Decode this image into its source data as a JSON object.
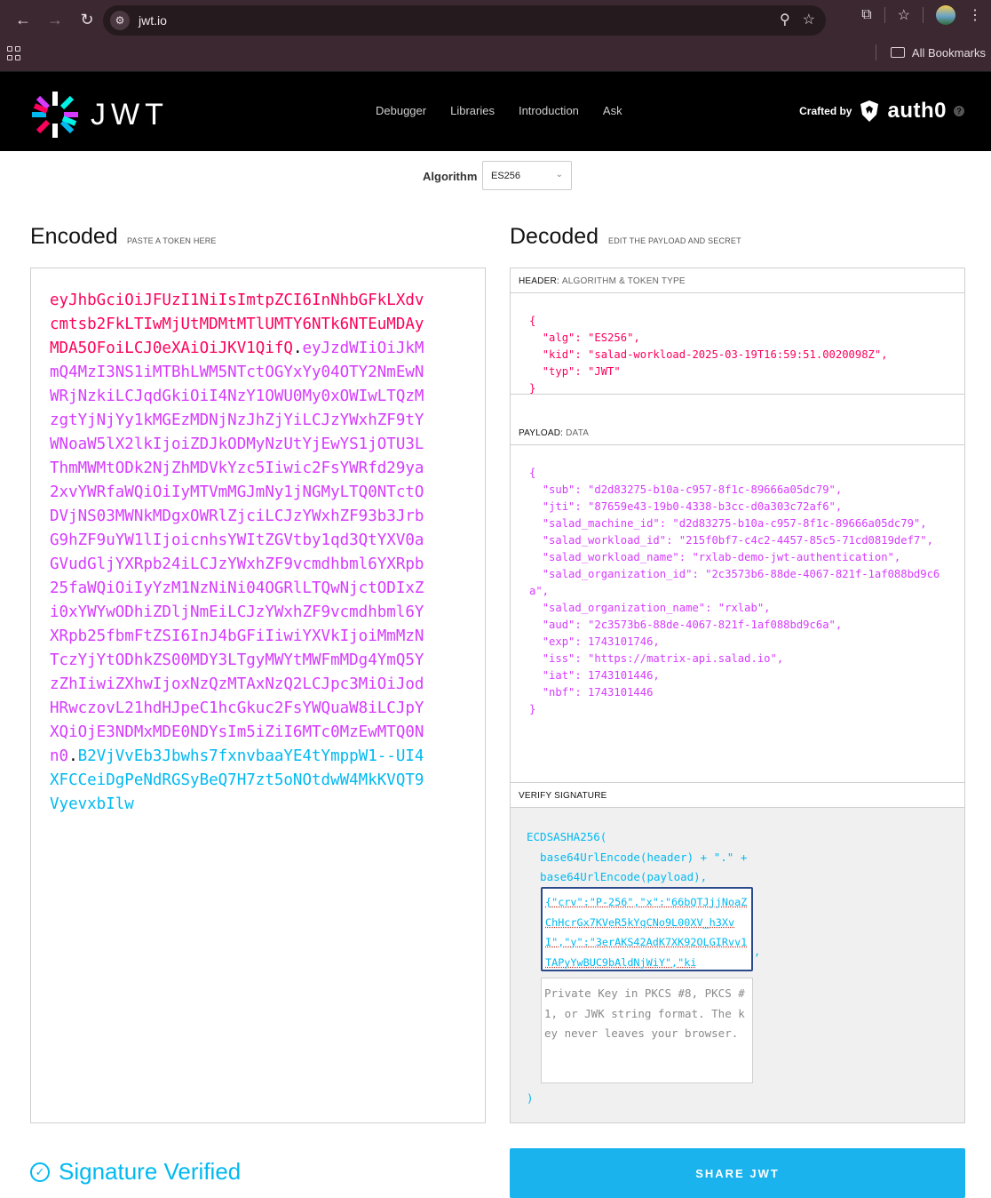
{
  "browser": {
    "url": "jwt.io",
    "bookmarks_label": "All Bookmarks"
  },
  "site": {
    "logo_text": "JWT",
    "nav": [
      "Debugger",
      "Libraries",
      "Introduction",
      "Ask"
    ],
    "crafted_by": "Crafted by",
    "crafted_brand": "auth0"
  },
  "algorithm": {
    "label": "Algorithm",
    "value": "ES256"
  },
  "encoded": {
    "title": "Encoded",
    "subtitle": "PASTE A TOKEN HERE",
    "header_part": "eyJhbGciOiJFUzI1NiIsImtpZCI6InNhbGFkLXdvcmtsb2FkLTIwMjUtMDMtMTlUMTY6NTk6NTEuMDAyMDA5OFoiLCJ0eXAiOiJKV1QifQ",
    "payload_part": "eyJzdWIiOiJkMmQ4MzI3NS1iMTBhLWM5NTctOGYxYy04OTY2NmEwNWRjNzkiLCJqdGkiOiI4NzY1OWU0My0xOWIwLTQzMzgtYjNjYy1kMGEzMDNjNzJhZjYiLCJzYWxhZF9tYWNoaW5lX2lkIjoiZDJkODMyNzUtYjEwYS1jOTU3LThmMWMtODk2NjZhMDVkYzc5Iiwic2FsYWRfd29ya2xvYWRfaWQiOiIyMTVmMGJmNy1jNGMyLTQ0NTctODVjNS03MWNkMDgxOWRlZjciLCJzYWxhZF93b3JrbG9hZF9uYW1lIjoicnhsYWItZGVtby1qd3QtYXV0aGVudGljYXRpb24iLCJzYWxhZF9vcmdhbml6YXRpb25faWQiOiIyYzM1NzNiNi04OGRlLTQwNjctODIxZi0xYWYwODhiZDljNmEiLCJzYWxhZF9vcmdhbml6YXRpb25fbmFtZSI6InJ4bGFiIiwiYXVkIjoiMmMzNTczYjYtODhkZS00MDY3LTgyMWYtMWFmMDg4YmQ5YzZhIiwiZXhwIjoxNzQzMTAxNzQ2LCJpc3MiOiJodHRwczovL21hdHJpeC1hcGkuc2FsYWQuaW8iLCJpYXQiOjE3NDMxMDE0NDYsIm5iZiI6MTc0MzEwMTQ0Nn0",
    "signature_part": "B2VjVvEb3Jbwhs7fxnvbaaYE4tYmppW1--UI4XFCCeiDgPeNdRGSyBeQ7H7zt5oNOtdwW4MkKVQT9VyevxbIlw",
    "dot": "."
  },
  "decoded": {
    "title": "Decoded",
    "subtitle": "EDIT THE PAYLOAD AND SECRET",
    "header_label": "HEADER:",
    "header_sub": "ALGORITHM & TOKEN TYPE",
    "header_json": "{\n  \"alg\": \"ES256\",\n  \"kid\": \"salad-workload-2025-03-19T16:59:51.0020098Z\",\n  \"typ\": \"JWT\"\n}",
    "payload_label": "PAYLOAD:",
    "payload_sub": "DATA",
    "payload_json": "{\n  \"sub\": \"d2d83275-b10a-c957-8f1c-89666a05dc79\",\n  \"jti\": \"87659e43-19b0-4338-b3cc-d0a303c72af6\",\n  \"salad_machine_id\": \"d2d83275-b10a-c957-8f1c-89666a05dc79\",\n  \"salad_workload_id\": \"215f0bf7-c4c2-4457-85c5-71cd0819def7\",\n  \"salad_workload_name\": \"rxlab-demo-jwt-authentication\",\n  \"salad_organization_id\": \"2c3573b6-88de-4067-821f-1af088bd9c6a\",\n  \"salad_organization_name\": \"rxlab\",\n  \"aud\": \"2c3573b6-88de-4067-821f-1af088bd9c6a\",\n  \"exp\": 1743101746,\n  \"iss\": \"https://matrix-api.salad.io\",\n  \"iat\": 1743101446,\n  \"nbf\": 1743101446\n}",
    "verify_label": "VERIFY SIGNATURE",
    "verify_code": "ECDSASHA256(\n  base64UrlEncode(header) + \".\" +\n  base64UrlEncode(payload),",
    "public_key": "{\"crv\":\"P-256\",\"x\":\"66bQTJjjNoaZChHcrGx7KVeR5kYqCNo9L00XV_h3XvI\",\"y\":\"3erAKS42AdK7XK92OLGIRvv1TAPyYwBUC9bAldNjWiY\",\"ki",
    "comma": ",",
    "private_key_placeholder": "Private Key in PKCS #8, PKCS #1, or JWK string format. The key never leaves your browser.",
    "close_paren": ")"
  },
  "status": {
    "verified_text": "Signature Verified",
    "share_button": "SHARE JWT"
  }
}
